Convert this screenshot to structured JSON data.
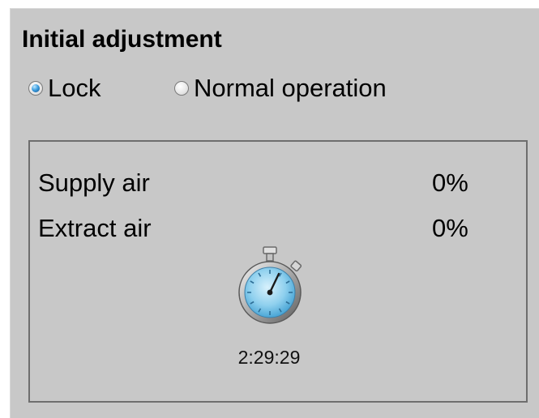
{
  "initial_adjustment": {
    "title": "Initial adjustment",
    "mode_options": [
      {
        "label": "Lock",
        "checked": true
      },
      {
        "label": "Normal operation",
        "checked": false
      }
    ],
    "supply_air": {
      "label": "Supply air",
      "value": "0%"
    },
    "extract_air": {
      "label": "Extract air",
      "value": "0%"
    },
    "timer": {
      "icon": "stopwatch-icon",
      "value": "2:29:29"
    }
  },
  "colors": {
    "panel_background": "#c8c8c8",
    "radio_selected": "#3f9fe0",
    "stopwatch_face": "#8fd0ee"
  }
}
